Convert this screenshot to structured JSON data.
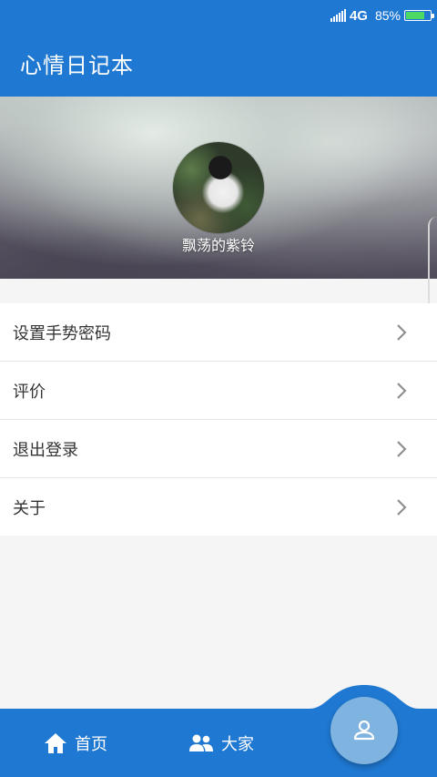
{
  "status_bar": {
    "network": "4G",
    "battery_text": "85%",
    "battery_level": 0.85,
    "battery_color": "#4cd964"
  },
  "app_bar": {
    "title": "心情日记本",
    "color": "#1f78d1"
  },
  "profile": {
    "username": "飘荡的紫铃"
  },
  "menu": {
    "items": [
      {
        "label": "设置手势密码",
        "icon": "chevron-right-icon"
      },
      {
        "label": "评价",
        "icon": "chevron-right-icon"
      },
      {
        "label": "退出登录",
        "icon": "chevron-right-icon"
      },
      {
        "label": "关于",
        "icon": "chevron-right-icon"
      }
    ]
  },
  "bottom_nav": {
    "home_label": "首页",
    "home_icon": "home-icon",
    "everyone_label": "大家",
    "everyone_icon": "people-icon",
    "profile_icon": "person-icon",
    "fab_color": "#7fb3e0"
  }
}
